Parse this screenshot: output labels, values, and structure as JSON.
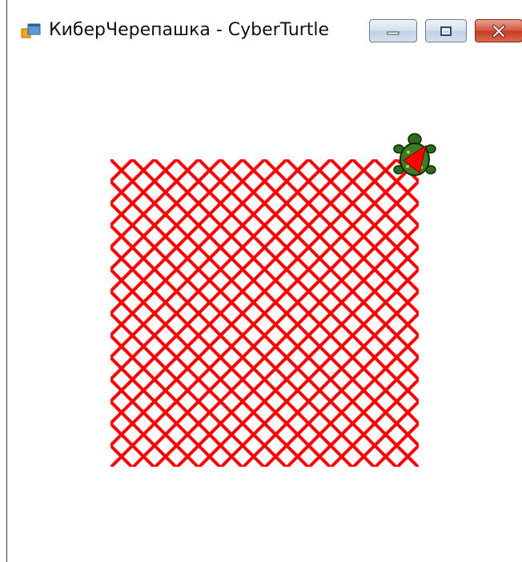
{
  "window": {
    "title": "КиберЧерепашка - CyberTurtle",
    "app_icon": "app-window-icon",
    "buttons": [
      {
        "name": "minimize-button",
        "icon": "minimize-icon"
      },
      {
        "name": "maximize-button",
        "icon": "maximize-icon"
      },
      {
        "name": "close-button",
        "icon": "close-icon"
      }
    ]
  },
  "canvas": {
    "pen_color": "#ff0000",
    "turtle_shell_color": "#2e6b1a",
    "turtle_head_color": "#ff0000",
    "pattern": "diagonal lattice",
    "turtle_icon": "turtle-icon"
  }
}
